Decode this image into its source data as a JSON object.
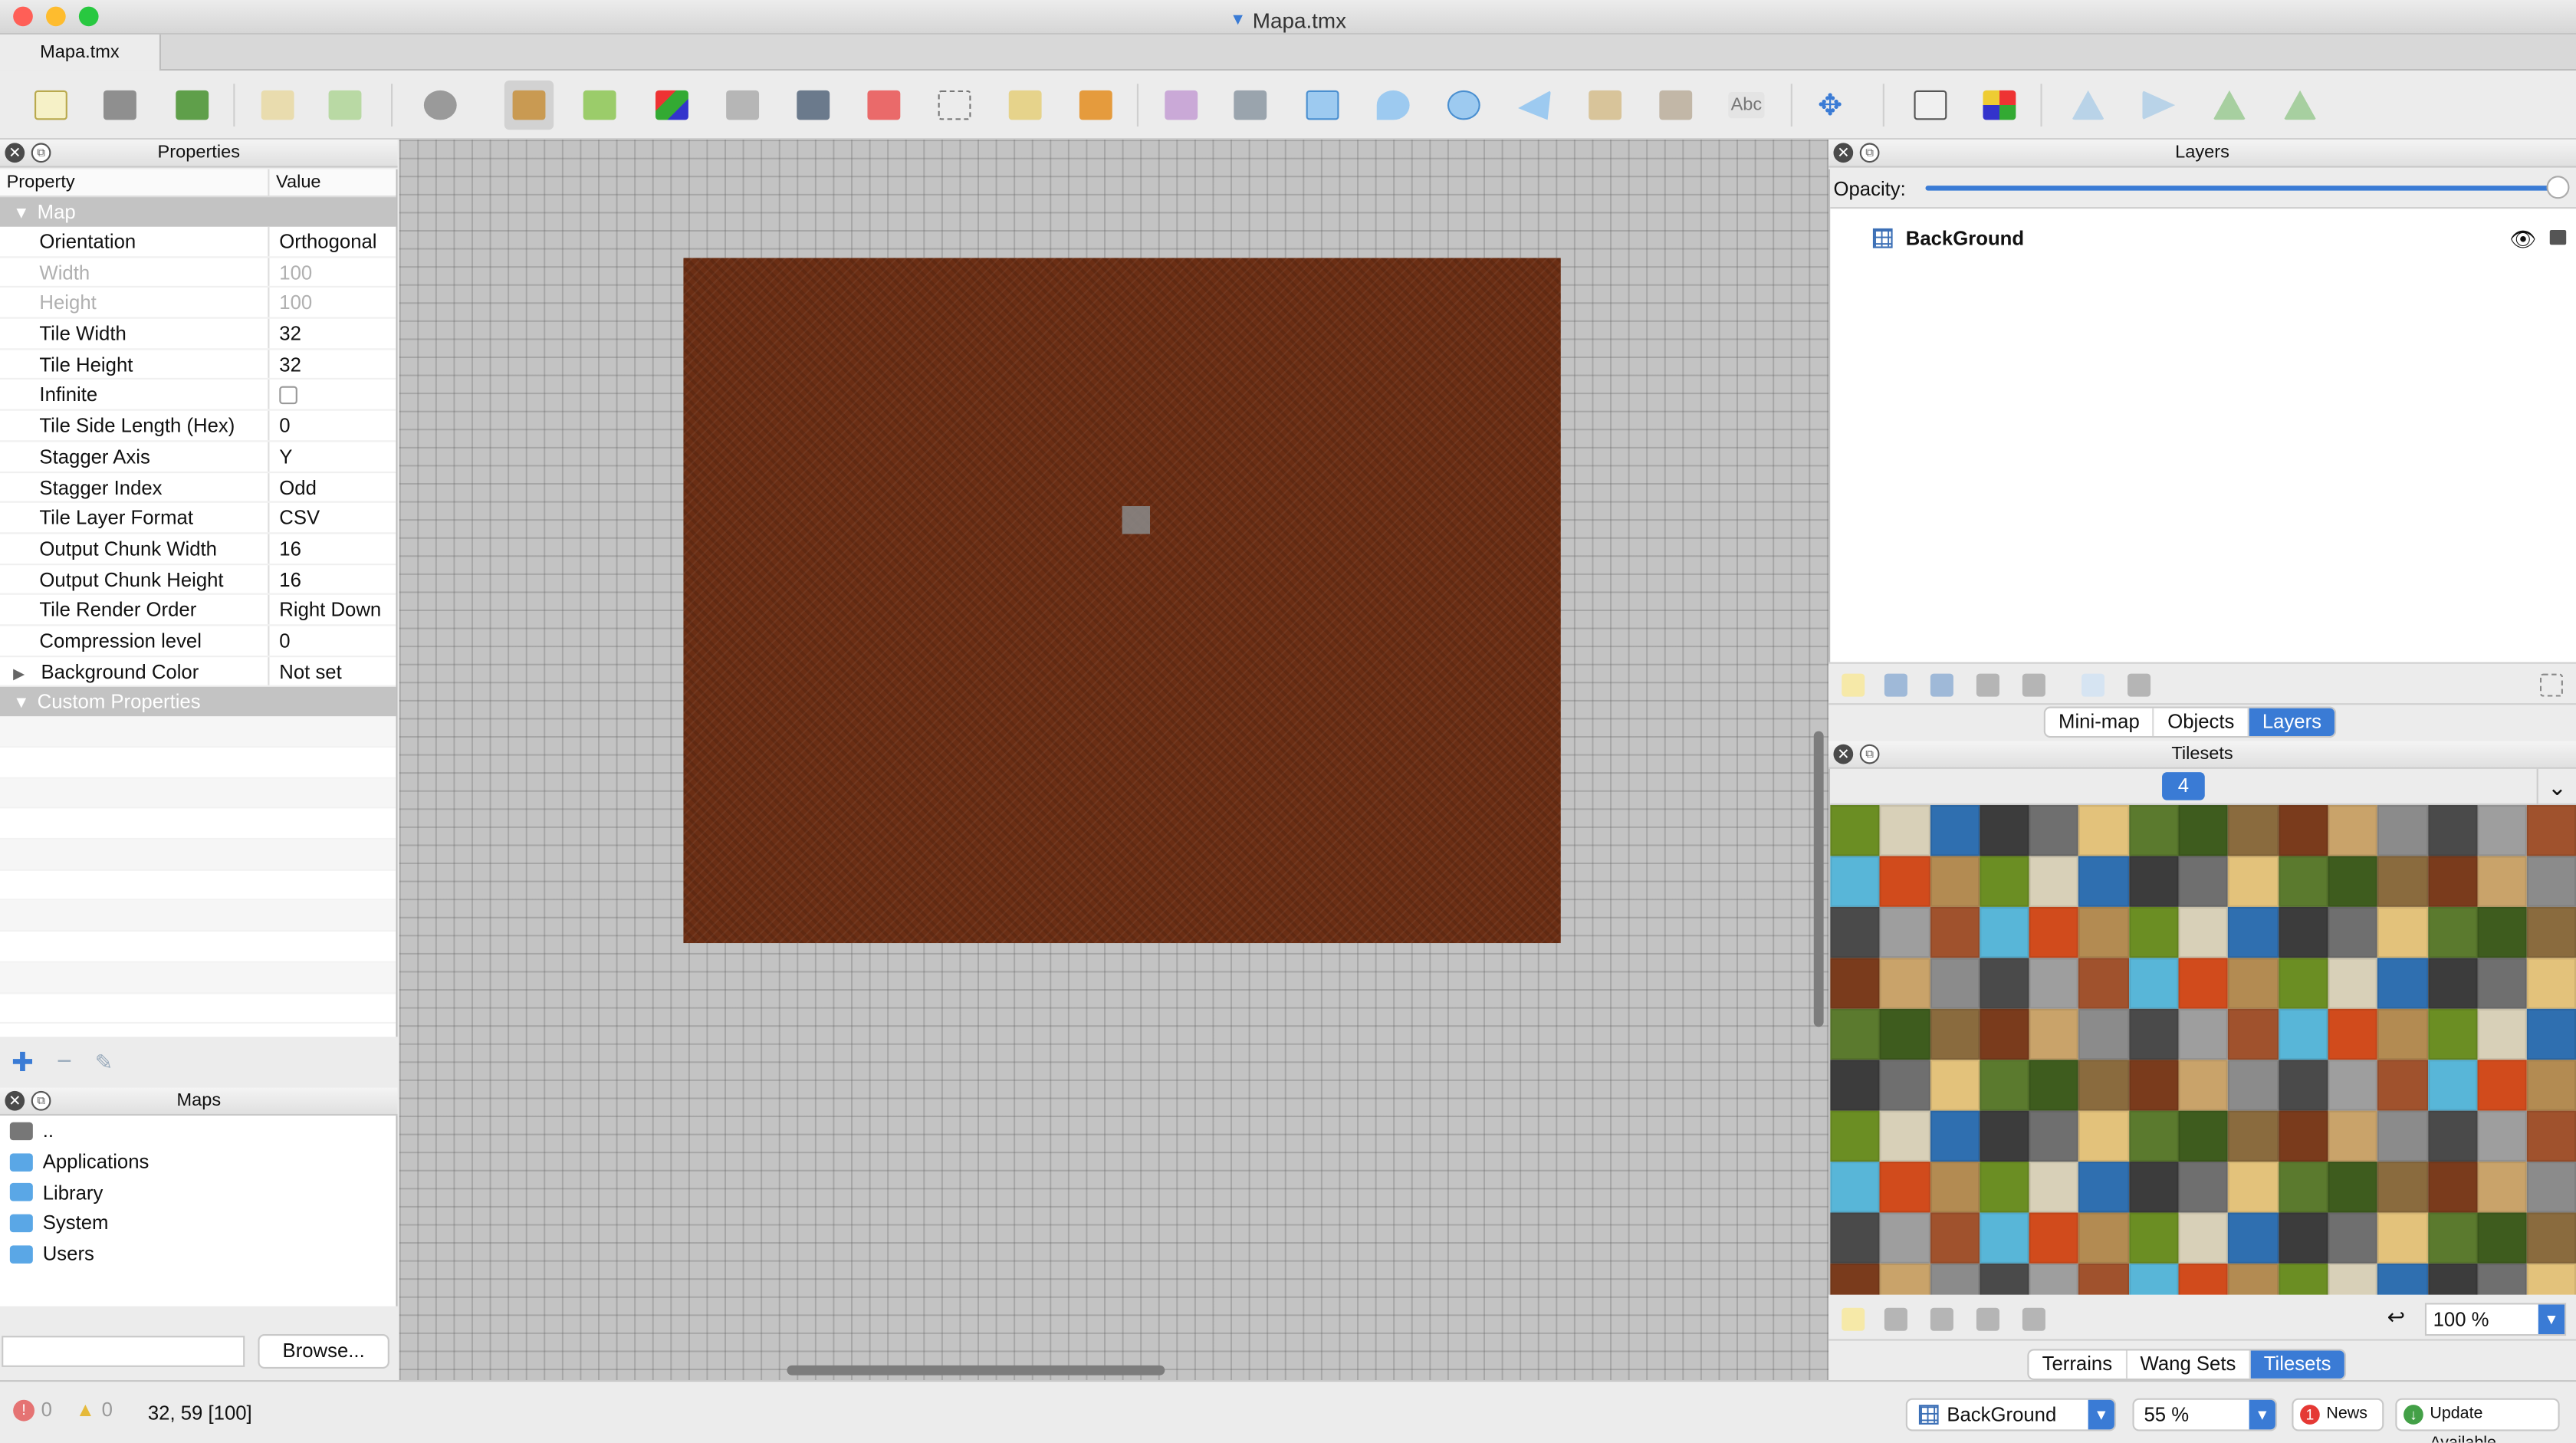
{
  "window": {
    "title": "Mapa.tmx",
    "doc_tab": "Mapa.tmx"
  },
  "colors": {
    "accent": "#3a7bd5",
    "map_fill": "#6b2e14",
    "canvas_bg": "#c3c3c3",
    "close": "#ff5f57",
    "minimize": "#febc2e",
    "zoom": "#28c840"
  },
  "toolbar": {
    "icons": [
      "new-map-icon",
      "open-icon",
      "save-icon",
      "undo-icon",
      "redo-icon",
      "commands-icon",
      "stamp-brush-icon",
      "terrain-brush-icon",
      "wang-brush-icon",
      "bucket-fill-icon",
      "shape-fill-icon",
      "eraser-icon",
      "rectangle-select-icon",
      "magic-wand-icon",
      "select-same-tile-icon",
      "select-objects-icon",
      "edit-polygons-icon",
      "insert-rectangle-icon",
      "insert-point-icon",
      "insert-ellipse-icon",
      "insert-polygon-icon",
      "insert-tile-icon",
      "insert-template-icon",
      "insert-text-icon",
      "move-icon",
      "random-mode-icon",
      "wang-fill-mode-icon",
      "flip-horizontal-icon",
      "flip-vertical-icon",
      "rotate-left-icon",
      "rotate-right-icon"
    ],
    "text_tool_label": "Abc"
  },
  "properties": {
    "title": "Properties",
    "col_property": "Property",
    "col_value": "Value",
    "group_map": "Map",
    "rows": [
      {
        "k": "Orientation",
        "v": "Orthogonal"
      },
      {
        "k": "Width",
        "v": "100",
        "disabled": true
      },
      {
        "k": "Height",
        "v": "100",
        "disabled": true
      },
      {
        "k": "Tile Width",
        "v": "32"
      },
      {
        "k": "Tile Height",
        "v": "32"
      },
      {
        "k": "Infinite",
        "v": ""
      },
      {
        "k": "Tile Side Length (Hex)",
        "v": "0"
      },
      {
        "k": "Stagger Axis",
        "v": "Y"
      },
      {
        "k": "Stagger Index",
        "v": "Odd"
      },
      {
        "k": "Tile Layer Format",
        "v": "CSV"
      },
      {
        "k": "Output Chunk Width",
        "v": "16"
      },
      {
        "k": "Output Chunk Height",
        "v": "16"
      },
      {
        "k": "Tile Render Order",
        "v": "Right Down"
      },
      {
        "k": "Compression level",
        "v": "0"
      },
      {
        "k": "Background Color",
        "v": "Not set"
      }
    ],
    "group_custom": "Custom Properties"
  },
  "maps": {
    "title": "Maps",
    "items": [
      "..",
      "Applications",
      "Library",
      "System",
      "Users"
    ],
    "browse_label": "Browse...",
    "path_value": ""
  },
  "layers": {
    "title": "Layers",
    "opacity_label": "Opacity:",
    "opacity": 1.0,
    "items": [
      {
        "name": "BackGround"
      }
    ],
    "tabs": [
      "Mini-map",
      "Objects",
      "Layers"
    ],
    "active_tab": "Layers"
  },
  "tilesets": {
    "title": "Tilesets",
    "tab_label": "4",
    "zoom": "100 %",
    "tabs": [
      "Terrains",
      "Wang Sets",
      "Tilesets"
    ],
    "active_tab": "Tilesets"
  },
  "status": {
    "errors": "0",
    "warnings": "0",
    "coords": "32, 59 [100]",
    "layer_select": "BackGround",
    "zoom": "55 %",
    "news_label": "News",
    "news_count": "1",
    "update_label": "Update Available"
  }
}
